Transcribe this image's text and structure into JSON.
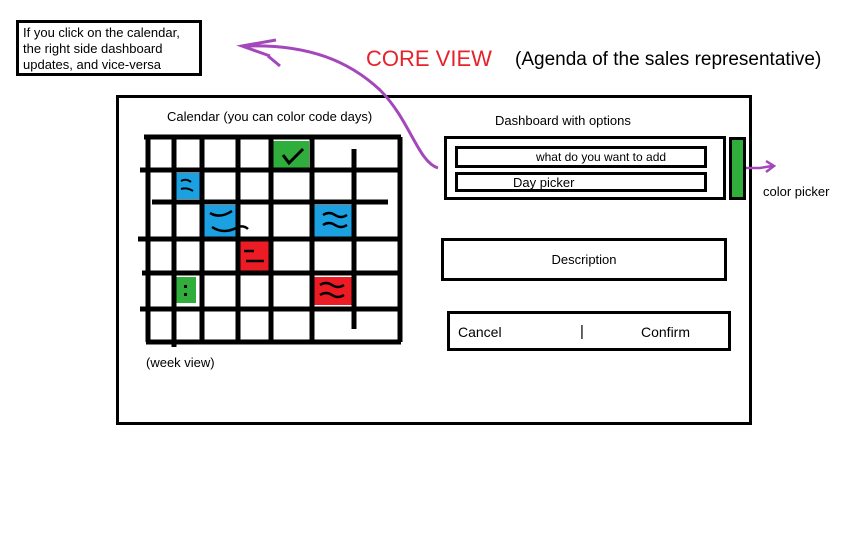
{
  "note": {
    "lines": [
      "If you click on the calendar,",
      "the right side dashboard",
      "updates, and vice-versa"
    ]
  },
  "header": {
    "title": "CORE VIEW",
    "title_color": "#e8212b",
    "subtitle": "(Agenda of the sales representative)"
  },
  "calendar": {
    "label": "Calendar (you can color code days)",
    "footer": "(week view)",
    "colors": {
      "green": "#2fae3c",
      "blue": "#1ba1e2",
      "red": "#ed1c24"
    }
  },
  "dashboard": {
    "label": "Dashboard with options",
    "add_field": "what do you want to add",
    "day_picker": "Day picker",
    "color_picker_label": "color picker",
    "description": "Description",
    "cancel": "Cancel",
    "separator": "|",
    "confirm": "Confirm"
  },
  "annotation": {
    "arrow_color": "#a347ba"
  }
}
